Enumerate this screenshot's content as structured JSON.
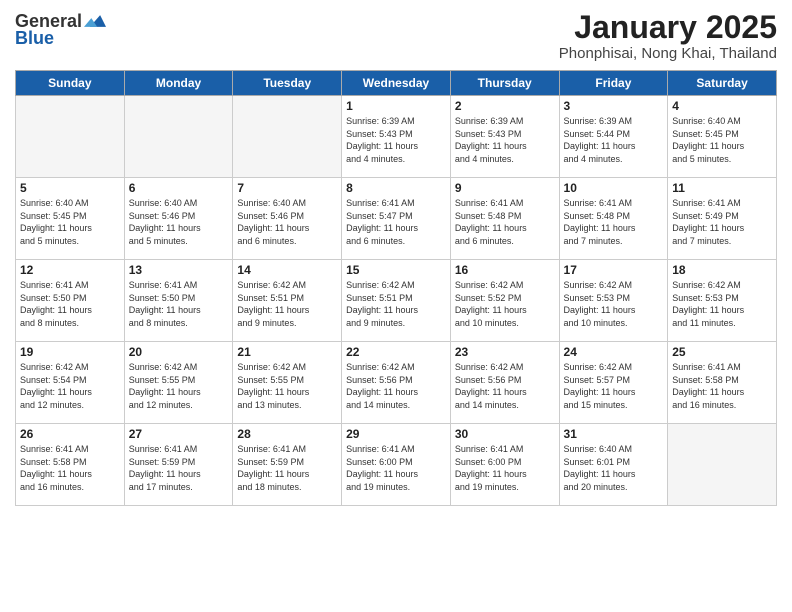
{
  "header": {
    "logo_general": "General",
    "logo_blue": "Blue",
    "title": "January 2025",
    "subtitle": "Phonphisai, Nong Khai, Thailand"
  },
  "days": [
    "Sunday",
    "Monday",
    "Tuesday",
    "Wednesday",
    "Thursday",
    "Friday",
    "Saturday"
  ],
  "weeks": [
    [
      {
        "date": "",
        "info": ""
      },
      {
        "date": "",
        "info": ""
      },
      {
        "date": "",
        "info": ""
      },
      {
        "date": "1",
        "info": "Sunrise: 6:39 AM\nSunset: 5:43 PM\nDaylight: 11 hours\nand 4 minutes."
      },
      {
        "date": "2",
        "info": "Sunrise: 6:39 AM\nSunset: 5:43 PM\nDaylight: 11 hours\nand 4 minutes."
      },
      {
        "date": "3",
        "info": "Sunrise: 6:39 AM\nSunset: 5:44 PM\nDaylight: 11 hours\nand 4 minutes."
      },
      {
        "date": "4",
        "info": "Sunrise: 6:40 AM\nSunset: 5:45 PM\nDaylight: 11 hours\nand 5 minutes."
      }
    ],
    [
      {
        "date": "5",
        "info": "Sunrise: 6:40 AM\nSunset: 5:45 PM\nDaylight: 11 hours\nand 5 minutes."
      },
      {
        "date": "6",
        "info": "Sunrise: 6:40 AM\nSunset: 5:46 PM\nDaylight: 11 hours\nand 5 minutes."
      },
      {
        "date": "7",
        "info": "Sunrise: 6:40 AM\nSunset: 5:46 PM\nDaylight: 11 hours\nand 6 minutes."
      },
      {
        "date": "8",
        "info": "Sunrise: 6:41 AM\nSunset: 5:47 PM\nDaylight: 11 hours\nand 6 minutes."
      },
      {
        "date": "9",
        "info": "Sunrise: 6:41 AM\nSunset: 5:48 PM\nDaylight: 11 hours\nand 6 minutes."
      },
      {
        "date": "10",
        "info": "Sunrise: 6:41 AM\nSunset: 5:48 PM\nDaylight: 11 hours\nand 7 minutes."
      },
      {
        "date": "11",
        "info": "Sunrise: 6:41 AM\nSunset: 5:49 PM\nDaylight: 11 hours\nand 7 minutes."
      }
    ],
    [
      {
        "date": "12",
        "info": "Sunrise: 6:41 AM\nSunset: 5:50 PM\nDaylight: 11 hours\nand 8 minutes."
      },
      {
        "date": "13",
        "info": "Sunrise: 6:41 AM\nSunset: 5:50 PM\nDaylight: 11 hours\nand 8 minutes."
      },
      {
        "date": "14",
        "info": "Sunrise: 6:42 AM\nSunset: 5:51 PM\nDaylight: 11 hours\nand 9 minutes."
      },
      {
        "date": "15",
        "info": "Sunrise: 6:42 AM\nSunset: 5:51 PM\nDaylight: 11 hours\nand 9 minutes."
      },
      {
        "date": "16",
        "info": "Sunrise: 6:42 AM\nSunset: 5:52 PM\nDaylight: 11 hours\nand 10 minutes."
      },
      {
        "date": "17",
        "info": "Sunrise: 6:42 AM\nSunset: 5:53 PM\nDaylight: 11 hours\nand 10 minutes."
      },
      {
        "date": "18",
        "info": "Sunrise: 6:42 AM\nSunset: 5:53 PM\nDaylight: 11 hours\nand 11 minutes."
      }
    ],
    [
      {
        "date": "19",
        "info": "Sunrise: 6:42 AM\nSunset: 5:54 PM\nDaylight: 11 hours\nand 12 minutes."
      },
      {
        "date": "20",
        "info": "Sunrise: 6:42 AM\nSunset: 5:55 PM\nDaylight: 11 hours\nand 12 minutes."
      },
      {
        "date": "21",
        "info": "Sunrise: 6:42 AM\nSunset: 5:55 PM\nDaylight: 11 hours\nand 13 minutes."
      },
      {
        "date": "22",
        "info": "Sunrise: 6:42 AM\nSunset: 5:56 PM\nDaylight: 11 hours\nand 14 minutes."
      },
      {
        "date": "23",
        "info": "Sunrise: 6:42 AM\nSunset: 5:56 PM\nDaylight: 11 hours\nand 14 minutes."
      },
      {
        "date": "24",
        "info": "Sunrise: 6:42 AM\nSunset: 5:57 PM\nDaylight: 11 hours\nand 15 minutes."
      },
      {
        "date": "25",
        "info": "Sunrise: 6:41 AM\nSunset: 5:58 PM\nDaylight: 11 hours\nand 16 minutes."
      }
    ],
    [
      {
        "date": "26",
        "info": "Sunrise: 6:41 AM\nSunset: 5:58 PM\nDaylight: 11 hours\nand 16 minutes."
      },
      {
        "date": "27",
        "info": "Sunrise: 6:41 AM\nSunset: 5:59 PM\nDaylight: 11 hours\nand 17 minutes."
      },
      {
        "date": "28",
        "info": "Sunrise: 6:41 AM\nSunset: 5:59 PM\nDaylight: 11 hours\nand 18 minutes."
      },
      {
        "date": "29",
        "info": "Sunrise: 6:41 AM\nSunset: 6:00 PM\nDaylight: 11 hours\nand 19 minutes."
      },
      {
        "date": "30",
        "info": "Sunrise: 6:41 AM\nSunset: 6:00 PM\nDaylight: 11 hours\nand 19 minutes."
      },
      {
        "date": "31",
        "info": "Sunrise: 6:40 AM\nSunset: 6:01 PM\nDaylight: 11 hours\nand 20 minutes."
      },
      {
        "date": "",
        "info": ""
      }
    ]
  ]
}
